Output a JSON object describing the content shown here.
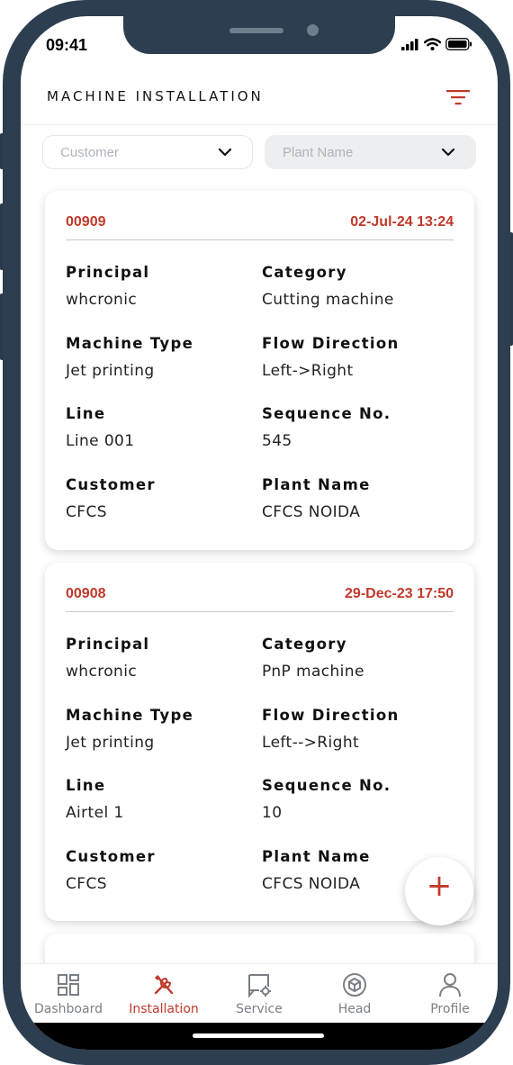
{
  "status": {
    "time": "09:41"
  },
  "header": {
    "title": "MACHINE INSTALLATION",
    "filter_icon": "filter-icon"
  },
  "filters": {
    "customer_placeholder": "Customer",
    "plant_placeholder": "Plant Name"
  },
  "cards": [
    {
      "id": "00909",
      "date": "02-Jul-24 13:24",
      "fields": [
        {
          "label": "Principal",
          "value": "whcronic"
        },
        {
          "label": "Category",
          "value": "Cutting machine"
        },
        {
          "label": "Machine Type",
          "value": "Jet printing"
        },
        {
          "label": "Flow Direction",
          "value": "Left->Right"
        },
        {
          "label": "Line",
          "value": "Line 001"
        },
        {
          "label": "Sequence No.",
          "value": "545"
        },
        {
          "label": "Customer",
          "value": "CFCS"
        },
        {
          "label": "Plant Name",
          "value": "CFCS NOIDA"
        }
      ]
    },
    {
      "id": "00908",
      "date": "29-Dec-23 17:50",
      "fields": [
        {
          "label": "Principal",
          "value": "whcronic"
        },
        {
          "label": "Category",
          "value": "PnP machine"
        },
        {
          "label": "Machine Type",
          "value": "Jet printing"
        },
        {
          "label": "Flow Direction",
          "value": "Left-->Right"
        },
        {
          "label": "Line",
          "value": "Airtel 1"
        },
        {
          "label": "Sequence No.",
          "value": "10"
        },
        {
          "label": "Customer",
          "value": "CFCS"
        },
        {
          "label": "Plant Name",
          "value": "CFCS NOIDA"
        }
      ]
    }
  ],
  "fab": {
    "label": "+"
  },
  "nav": [
    {
      "label": "Dashboard",
      "icon": "dashboard-icon"
    },
    {
      "label": "Installation",
      "icon": "tools-icon"
    },
    {
      "label": "Service",
      "icon": "service-icon"
    },
    {
      "label": "Head",
      "icon": "cube-icon"
    },
    {
      "label": "Profile",
      "icon": "user-icon"
    }
  ],
  "colors": {
    "accent": "#c0392b",
    "frame": "#2c3e50",
    "muted": "#7a7f85"
  }
}
